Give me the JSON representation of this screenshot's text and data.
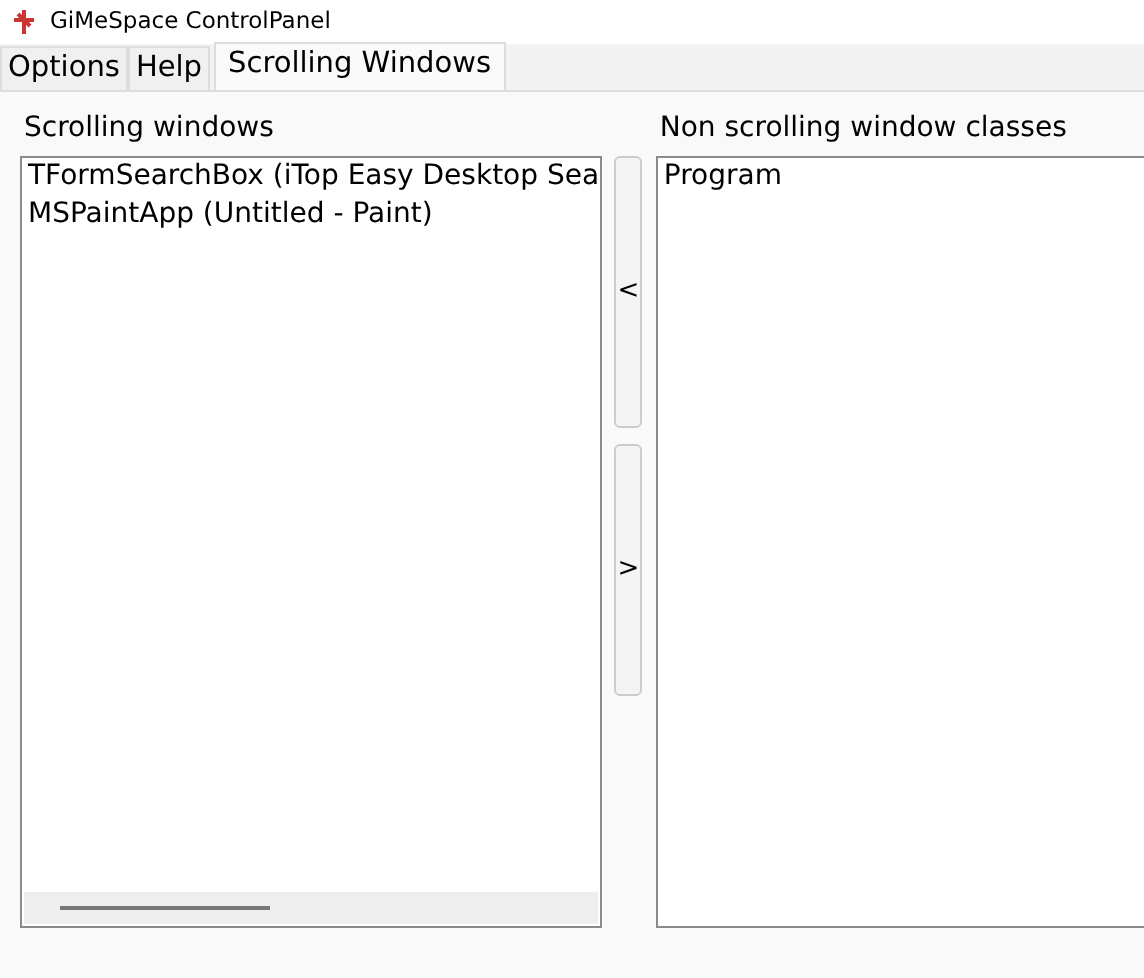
{
  "window": {
    "title": "GiMeSpace ControlPanel"
  },
  "tabs": [
    {
      "label": "Options",
      "selected": false
    },
    {
      "label": "Help",
      "selected": false
    },
    {
      "label": "Scrolling Windows",
      "selected": true
    }
  ],
  "scrolling_windows": {
    "label": "Scrolling windows",
    "items": [
      "TFormSearchBox (iTop Easy Desktop Sea",
      "MSPaintApp (Untitled - Paint)"
    ]
  },
  "move_buttons": [
    "<",
    ">"
  ],
  "non_scrolling": {
    "label": "Non scrolling window classes",
    "items": [
      "Program"
    ]
  }
}
